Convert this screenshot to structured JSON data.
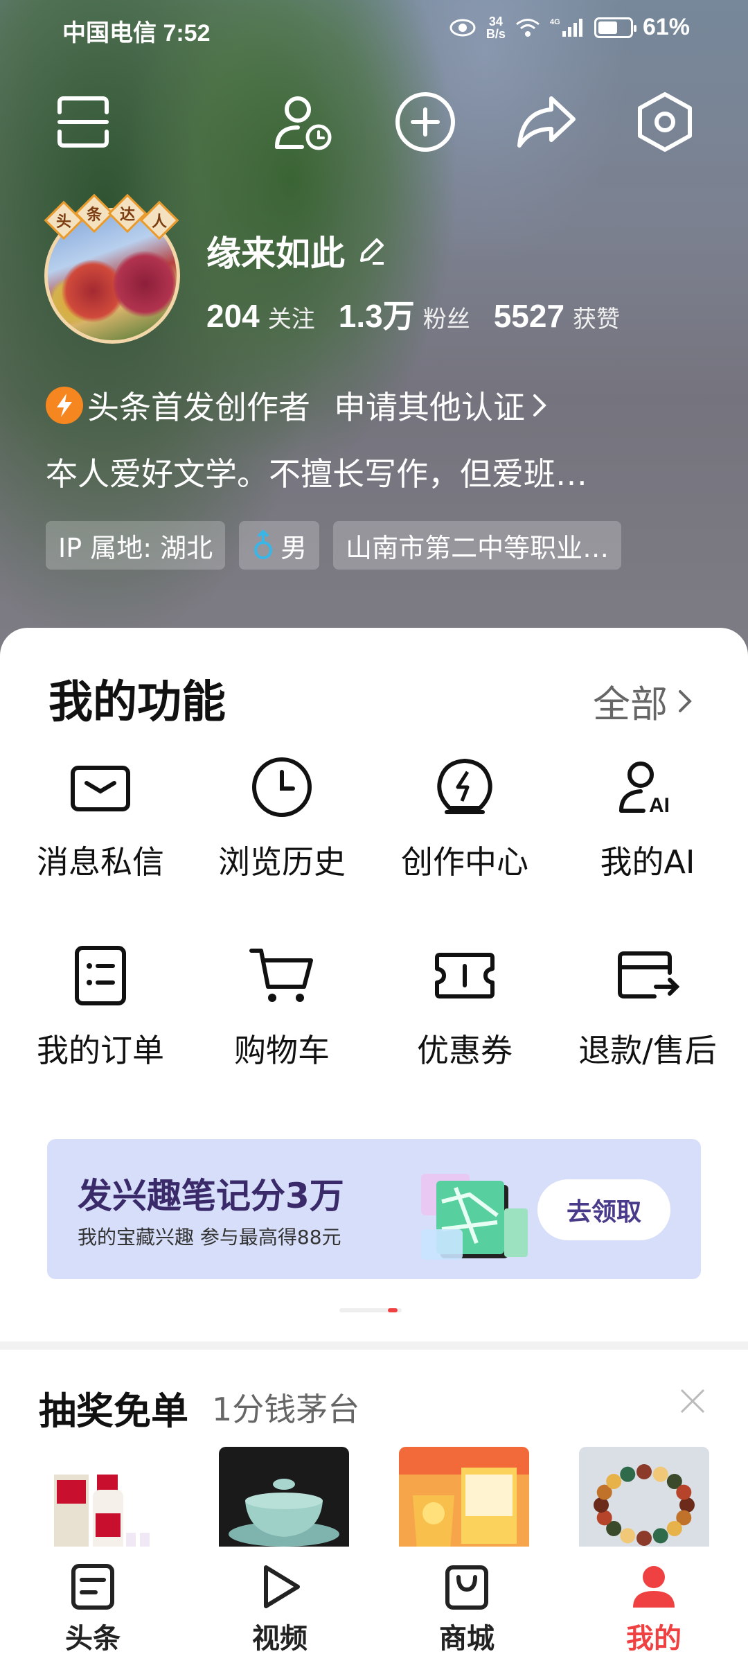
{
  "status_bar": {
    "carrier_time": "中国电信 7:52",
    "net_speed_top": "34",
    "net_speed_unit": "B/s",
    "network": "4G",
    "battery": "61%",
    "battery_level": 0.61
  },
  "profile": {
    "name": "缘来如此",
    "badge_chars": [
      "头",
      "条",
      "达",
      "人"
    ],
    "following_count": "204",
    "following_label": "关注",
    "fans_count": "1.3万",
    "fans_label": "粉丝",
    "likes_count": "5527",
    "likes_label": "获赞",
    "certification": "头条首发创作者",
    "apply_cert": "申请其他认证",
    "bio": "夲人爱好文学。不擅长写作，但爱班…",
    "tags": {
      "ip": "IP 属地: 湖北",
      "gender": "男",
      "school": "山南市第二中等职业…"
    }
  },
  "functions": {
    "title": "我的功能",
    "all_label": "全部",
    "items": [
      {
        "label": "消息私信",
        "icon": "message-icon"
      },
      {
        "label": "浏览历史",
        "icon": "clock-icon"
      },
      {
        "label": "创作中心",
        "icon": "creation-icon"
      },
      {
        "label": "我的AI",
        "icon": "ai-user-icon"
      },
      {
        "label": "我的订单",
        "icon": "order-icon"
      },
      {
        "label": "购物车",
        "icon": "cart-icon"
      },
      {
        "label": "优惠券",
        "icon": "coupon-icon"
      },
      {
        "label": "退款/售后",
        "icon": "refund-icon"
      }
    ]
  },
  "banner": {
    "title": "发兴趣笔记分3万",
    "subtitle": "我的宝藏兴趣 参与最高得88元",
    "button": "去领取"
  },
  "lottery": {
    "title": "抽奖免单",
    "subtitle": "1分钱茅台"
  },
  "tabbar": {
    "items": [
      "头条",
      "视频",
      "商城",
      "我的"
    ],
    "active": "我的",
    "active_color": "#f04142"
  }
}
